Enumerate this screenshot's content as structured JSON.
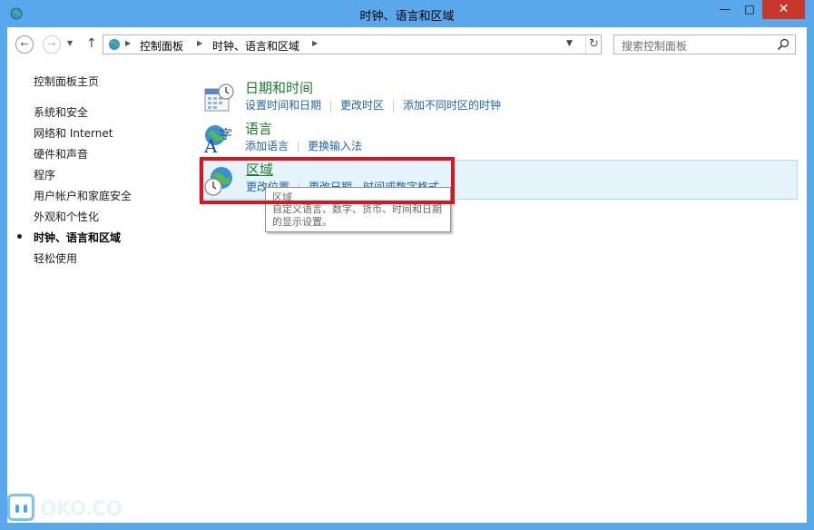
{
  "window": {
    "title": "时钟、语言和区域",
    "minimize": "—",
    "maximize": "□",
    "close": "✕"
  },
  "address": {
    "crumbs": [
      "控制面板",
      "时钟、语言和区域"
    ],
    "search_placeholder": "搜索控制面板"
  },
  "sidebar": {
    "home": "控制面板主页",
    "items": [
      {
        "label": "系统和安全"
      },
      {
        "label": "网络和 Internet"
      },
      {
        "label": "硬件和声音"
      },
      {
        "label": "程序"
      },
      {
        "label": "用户帐户和家庭安全"
      },
      {
        "label": "外观和个性化"
      },
      {
        "label": "时钟、语言和区域",
        "active": true
      },
      {
        "label": "轻松使用"
      }
    ]
  },
  "categories": [
    {
      "title": "日期和时间",
      "icon": "calendar-clock-icon",
      "links": [
        "设置时间和日期",
        "更改时区",
        "添加不同时区的时钟"
      ]
    },
    {
      "title": "语言",
      "icon": "language-globe-icon",
      "links": [
        "添加语言",
        "更换输入法"
      ]
    },
    {
      "title": "区域",
      "icon": "region-globe-clock-icon",
      "links": [
        "更改位置",
        "更改日期、时间或数字格式"
      ],
      "highlighted": true
    }
  ],
  "tooltip": {
    "title": "区域",
    "body": "自定义语言、数字、货币、时间和日期的显示设置。"
  },
  "watermark": {
    "text": "OKO.CO"
  },
  "colors": {
    "frame": "#5aa8ec",
    "link": "#1f64b4",
    "category_title": "#1f7c2c",
    "close_button": "#c7372c",
    "annotation": "#d8161b",
    "highlight": "#e5f3fb"
  }
}
